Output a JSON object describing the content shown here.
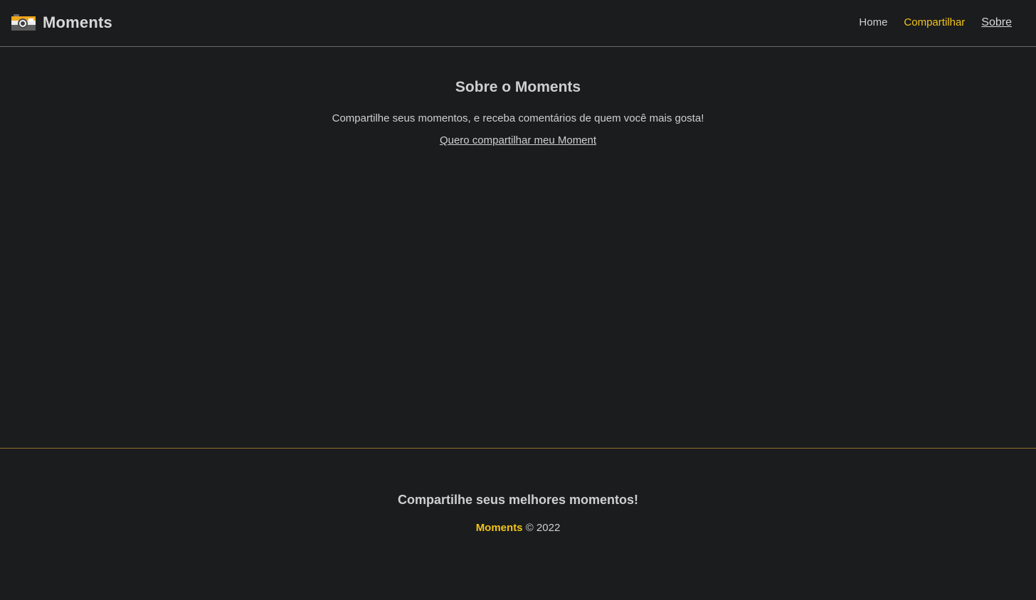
{
  "header": {
    "brand_name": "Moments",
    "brand_icon": "camera-icon",
    "nav": {
      "home": "Home",
      "share": "Compartilhar",
      "about": "Sobre"
    }
  },
  "main": {
    "title": "Sobre o Moments",
    "description": "Compartilhe seus momentos, e receba comentários de quem você mais gosta!",
    "share_link": "Quero compartilhar meu Moment"
  },
  "footer": {
    "tagline": "Compartilhe seus melhores momentos!",
    "brand": "Moments",
    "copyright": "© 2022"
  },
  "colors": {
    "background": "#1b1c1e",
    "accent": "#f0c419",
    "text": "#cfcfcf"
  }
}
